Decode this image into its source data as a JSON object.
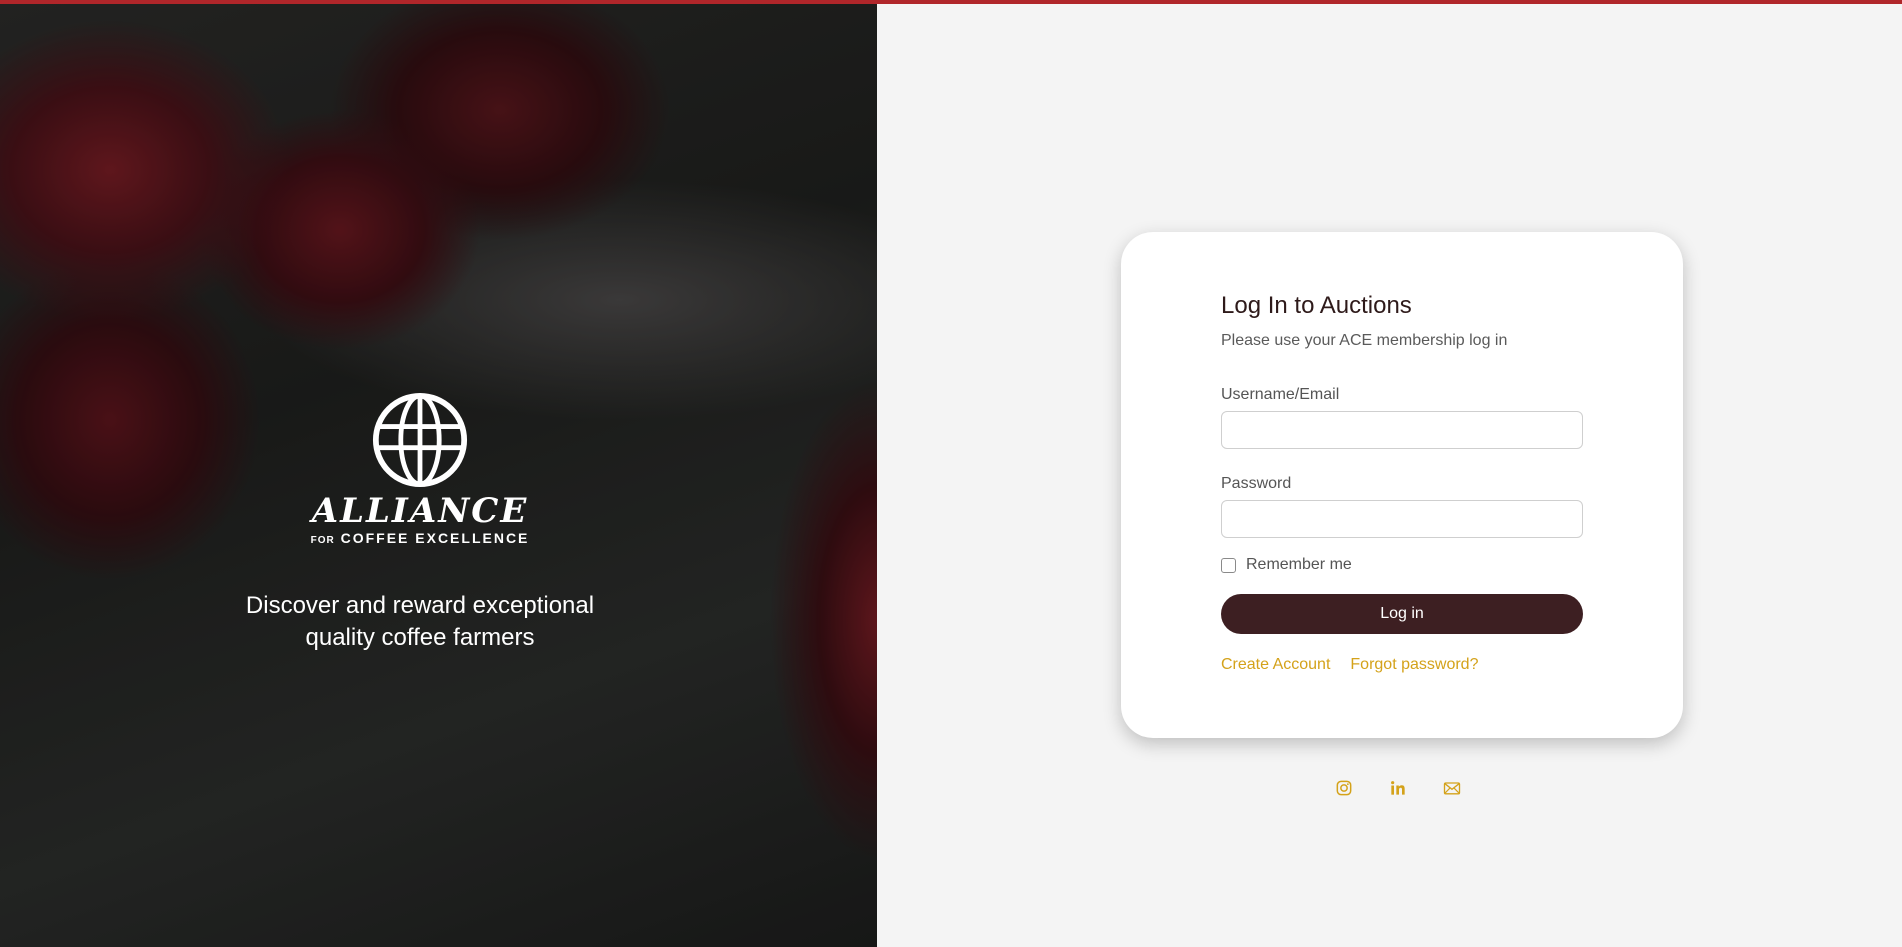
{
  "colors": {
    "accent": "#d4a21a",
    "button": "#3d1f22",
    "top_strip": "#b0262a",
    "panel_bg": "#f4f4f4"
  },
  "hero": {
    "logo": {
      "word": "ALLIANCE",
      "sub_small": "FOR",
      "sub_main": "COFFEE EXCELLENCE"
    },
    "tagline_line1": "Discover and reward exceptional",
    "tagline_line2": "quality coffee farmers"
  },
  "login": {
    "title": "Log In to Auctions",
    "subtitle": "Please use your ACE membership log in",
    "username_label": "Username/Email",
    "username_value": "",
    "password_label": "Password",
    "password_value": "",
    "remember_label": "Remember me",
    "remember_checked": false,
    "submit_label": "Log in",
    "create_account": "Create Account",
    "forgot_password": "Forgot password?"
  },
  "socials": [
    {
      "icon": "instagram-icon"
    },
    {
      "icon": "linkedin-icon"
    },
    {
      "icon": "email-icon"
    }
  ]
}
